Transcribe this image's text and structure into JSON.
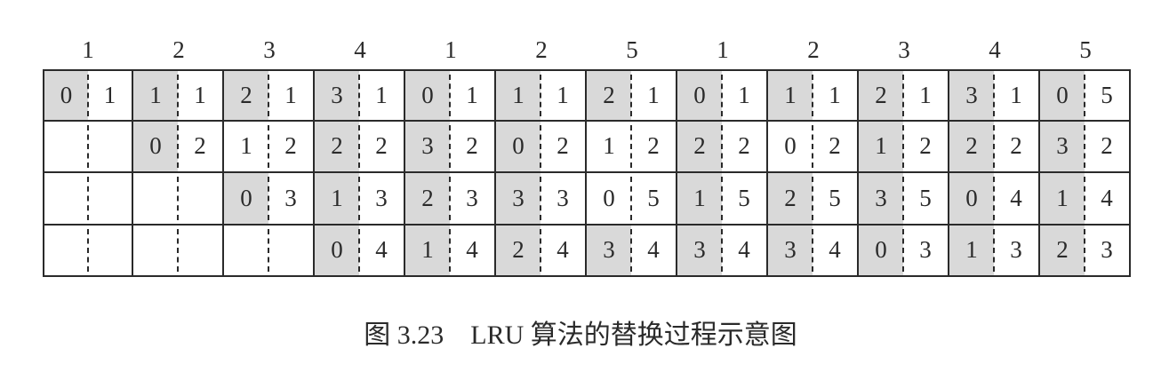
{
  "caption": "图 3.23　LRU 算法的替换过程示意图",
  "reference_string": [
    "1",
    "2",
    "3",
    "4",
    "1",
    "2",
    "5",
    "1",
    "2",
    "3",
    "4",
    "5"
  ],
  "shade_color": "#d9d9d9",
  "columns": [
    {
      "rows": [
        {
          "counter": "0",
          "page": "1",
          "shaded": true
        },
        null,
        null,
        null
      ]
    },
    {
      "rows": [
        {
          "counter": "1",
          "page": "1",
          "shaded": true
        },
        {
          "counter": "0",
          "page": "2",
          "shaded": true
        },
        null,
        null
      ]
    },
    {
      "rows": [
        {
          "counter": "2",
          "page": "1",
          "shaded": true
        },
        {
          "counter": "1",
          "page": "2",
          "shaded": false
        },
        {
          "counter": "0",
          "page": "3",
          "shaded": true
        },
        null
      ]
    },
    {
      "rows": [
        {
          "counter": "3",
          "page": "1",
          "shaded": true
        },
        {
          "counter": "2",
          "page": "2",
          "shaded": true
        },
        {
          "counter": "1",
          "page": "3",
          "shaded": true
        },
        {
          "counter": "0",
          "page": "4",
          "shaded": true
        }
      ]
    },
    {
      "rows": [
        {
          "counter": "0",
          "page": "1",
          "shaded": true
        },
        {
          "counter": "3",
          "page": "2",
          "shaded": true
        },
        {
          "counter": "2",
          "page": "3",
          "shaded": true
        },
        {
          "counter": "1",
          "page": "4",
          "shaded": true
        }
      ]
    },
    {
      "rows": [
        {
          "counter": "1",
          "page": "1",
          "shaded": true
        },
        {
          "counter": "0",
          "page": "2",
          "shaded": true
        },
        {
          "counter": "3",
          "page": "3",
          "shaded": true
        },
        {
          "counter": "2",
          "page": "4",
          "shaded": true
        }
      ]
    },
    {
      "rows": [
        {
          "counter": "2",
          "page": "1",
          "shaded": true
        },
        {
          "counter": "1",
          "page": "2",
          "shaded": false
        },
        {
          "counter": "0",
          "page": "5",
          "shaded": false
        },
        {
          "counter": "3",
          "page": "4",
          "shaded": true
        }
      ]
    },
    {
      "rows": [
        {
          "counter": "0",
          "page": "1",
          "shaded": true
        },
        {
          "counter": "2",
          "page": "2",
          "shaded": true
        },
        {
          "counter": "1",
          "page": "5",
          "shaded": true
        },
        {
          "counter": "3",
          "page": "4",
          "shaded": true
        }
      ]
    },
    {
      "rows": [
        {
          "counter": "1",
          "page": "1",
          "shaded": true
        },
        {
          "counter": "0",
          "page": "2",
          "shaded": false
        },
        {
          "counter": "2",
          "page": "5",
          "shaded": true
        },
        {
          "counter": "3",
          "page": "4",
          "shaded": true
        }
      ]
    },
    {
      "rows": [
        {
          "counter": "2",
          "page": "1",
          "shaded": true
        },
        {
          "counter": "1",
          "page": "2",
          "shaded": true
        },
        {
          "counter": "3",
          "page": "5",
          "shaded": true
        },
        {
          "counter": "0",
          "page": "3",
          "shaded": true
        }
      ]
    },
    {
      "rows": [
        {
          "counter": "3",
          "page": "1",
          "shaded": true
        },
        {
          "counter": "2",
          "page": "2",
          "shaded": true
        },
        {
          "counter": "0",
          "page": "4",
          "shaded": true
        },
        {
          "counter": "1",
          "page": "3",
          "shaded": true
        }
      ]
    },
    {
      "rows": [
        {
          "counter": "0",
          "page": "5",
          "shaded": true
        },
        {
          "counter": "3",
          "page": "2",
          "shaded": true
        },
        {
          "counter": "1",
          "page": "4",
          "shaded": true
        },
        {
          "counter": "2",
          "page": "3",
          "shaded": true
        }
      ]
    }
  ]
}
